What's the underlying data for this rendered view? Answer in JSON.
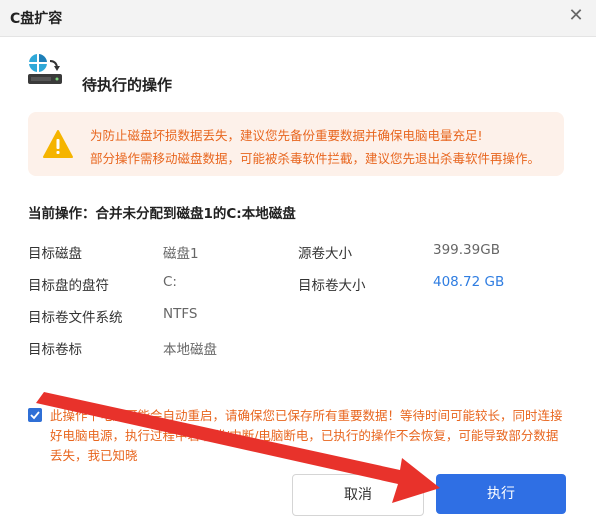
{
  "window": {
    "title": "C盘扩容"
  },
  "header": {
    "title": "待执行的操作"
  },
  "warning": {
    "line1": "为防止磁盘坏损数据丢失，建议您先备份重要数据并确保电脑电量充足!",
    "line2": "部分操作需移动磁盘数据，可能被杀毒软件拦截，建议您先退出杀毒软件再操作。"
  },
  "current_operation": "当前操作：合并未分配到磁盘1的C:本地磁盘",
  "details": {
    "target_disk_label": "目标磁盘",
    "target_disk_value": "磁盘1",
    "drive_letter_label": "目标盘的盘符",
    "drive_letter_value": "C:",
    "filesystem_label": "目标卷文件系统",
    "filesystem_value": "NTFS",
    "volume_label_label": "目标卷标",
    "volume_label_value": "本地磁盘",
    "source_size_label": "源卷大小",
    "source_size_value": "399.39GB",
    "target_size_label": "目标卷大小",
    "target_size_value": "408.72 GB"
  },
  "agreement": {
    "checked": true,
    "text": "此操作下电脑可能会自动重启，请确保您已保存所有重要数据！等待时间可能较长，同时连接好电脑电源，执行过程中若取消/中断/电脑断电，已执行的操作不会恢复，可能导致部分数据丢失，我已知晓"
  },
  "buttons": {
    "cancel": "取消",
    "execute": "执行"
  },
  "colors": {
    "accent": "#2f6fe4",
    "warning": "#e8661f",
    "warning_bg": "#fdf1ea",
    "annotation_arrow": "#e8322b"
  }
}
